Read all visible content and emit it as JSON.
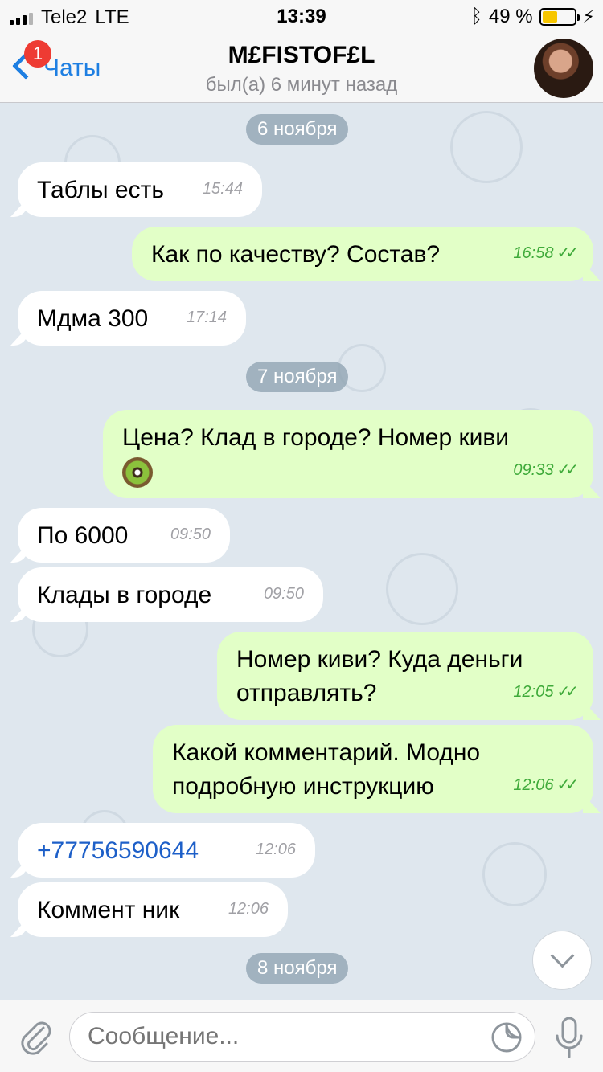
{
  "status_bar": {
    "carrier": "Tele2",
    "network": "LTE",
    "time": "13:39",
    "battery": "49 %",
    "battery_level": 0.49
  },
  "nav": {
    "back_label": "Чаты",
    "badge_count": "1",
    "title": "M£FISTOF£L",
    "subtitle": "был(а) 6 минут назад"
  },
  "dates": [
    "6 ноября",
    "7 ноября",
    "8 ноября"
  ],
  "messages": [
    {
      "dir": "in",
      "text": "Таблы есть",
      "time": "15:44"
    },
    {
      "dir": "out",
      "text": "Как по качеству? Состав?",
      "time": "16:58"
    },
    {
      "dir": "in",
      "text": "Мдма 300",
      "time": "17:14"
    },
    {
      "dir": "out",
      "text": "Цена? Клад в городе? Номер киви",
      "time": "09:33"
    },
    {
      "dir": "in",
      "text": "По 6000",
      "time": "09:50"
    },
    {
      "dir": "in",
      "text": "Клады в городе",
      "time": "09:50"
    },
    {
      "dir": "out",
      "text": "Номер киви? Куда деньги отправлять?",
      "time": "12:05"
    },
    {
      "dir": "out",
      "text": "Какой комментарий. Модно подробную инструкцию",
      "time": "12:06"
    },
    {
      "dir": "in",
      "text": "+77756590644",
      "time": "12:06"
    },
    {
      "dir": "in",
      "text": "Коммент ник",
      "time": "12:06"
    }
  ],
  "input": {
    "placeholder": "Сообщение..."
  },
  "colors": {
    "accent": "#1e7fe2",
    "outgoing_bubble": "#e2ffc7",
    "incoming_bubble": "#ffffff",
    "read_ticks": "#3faa3a",
    "chat_bg": "#dfe7ee",
    "badge": "#ee3b33"
  }
}
